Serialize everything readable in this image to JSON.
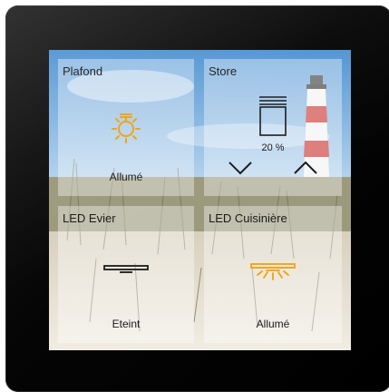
{
  "tiles": {
    "plafond": {
      "title": "Plafond",
      "status": "Allumé",
      "icon": "sun-icon"
    },
    "store": {
      "title": "Store",
      "position": "20 %",
      "icon": "window-blind-icon"
    },
    "led_evier": {
      "title": "LED Evier",
      "status": "Eteint",
      "icon": "light-bar-off-icon"
    },
    "led_cuisiniere": {
      "title": "LED Cuisinière",
      "status": "Allumé",
      "icon": "light-bar-on-icon"
    }
  },
  "colors": {
    "accent_on": "#f2a20c",
    "icon_off": "#1a1a1a"
  }
}
